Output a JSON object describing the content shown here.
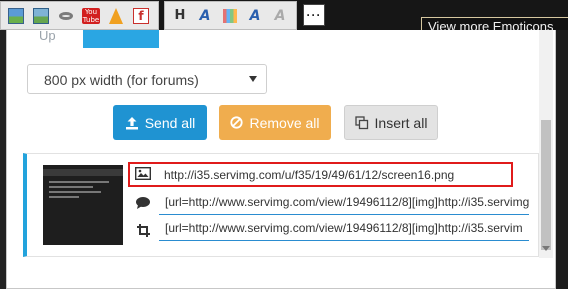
{
  "toolbar": {
    "group1": [
      "image-upload-icon",
      "image-host-icon",
      "link-icon",
      "youtube-icon",
      "cone-icon",
      "flash-icon"
    ],
    "youtube_text": "You Tube",
    "group2_labels": {
      "heading": "H",
      "font_a": "A",
      "font_a2": "A"
    },
    "more_label": "···"
  },
  "emoticons_tooltip": "View more Emoticons",
  "popup": {
    "tab_prev_label": "Up",
    "width_select": {
      "value": "800 px width (for forums)"
    },
    "buttons": {
      "send_all": "Send all",
      "remove_all": "Remove all",
      "insert_all": "Insert all"
    },
    "image_card": {
      "direct_link": "http://i35.servimg.com/u/f35/19/49/61/12/screen16.png",
      "bbcode_link": "[url=http://www.servimg.com/view/19496112/8][img]http://i35.servimg",
      "bbcode_thumb": "[url=http://www.servimg.com/view/19496112/8][img]http://i35.servim"
    }
  },
  "colors": {
    "accent": "#2aa6e3",
    "send_button": "#1f93d2",
    "remove_button": "#f0ad4e",
    "highlight": "#e01b1b"
  }
}
